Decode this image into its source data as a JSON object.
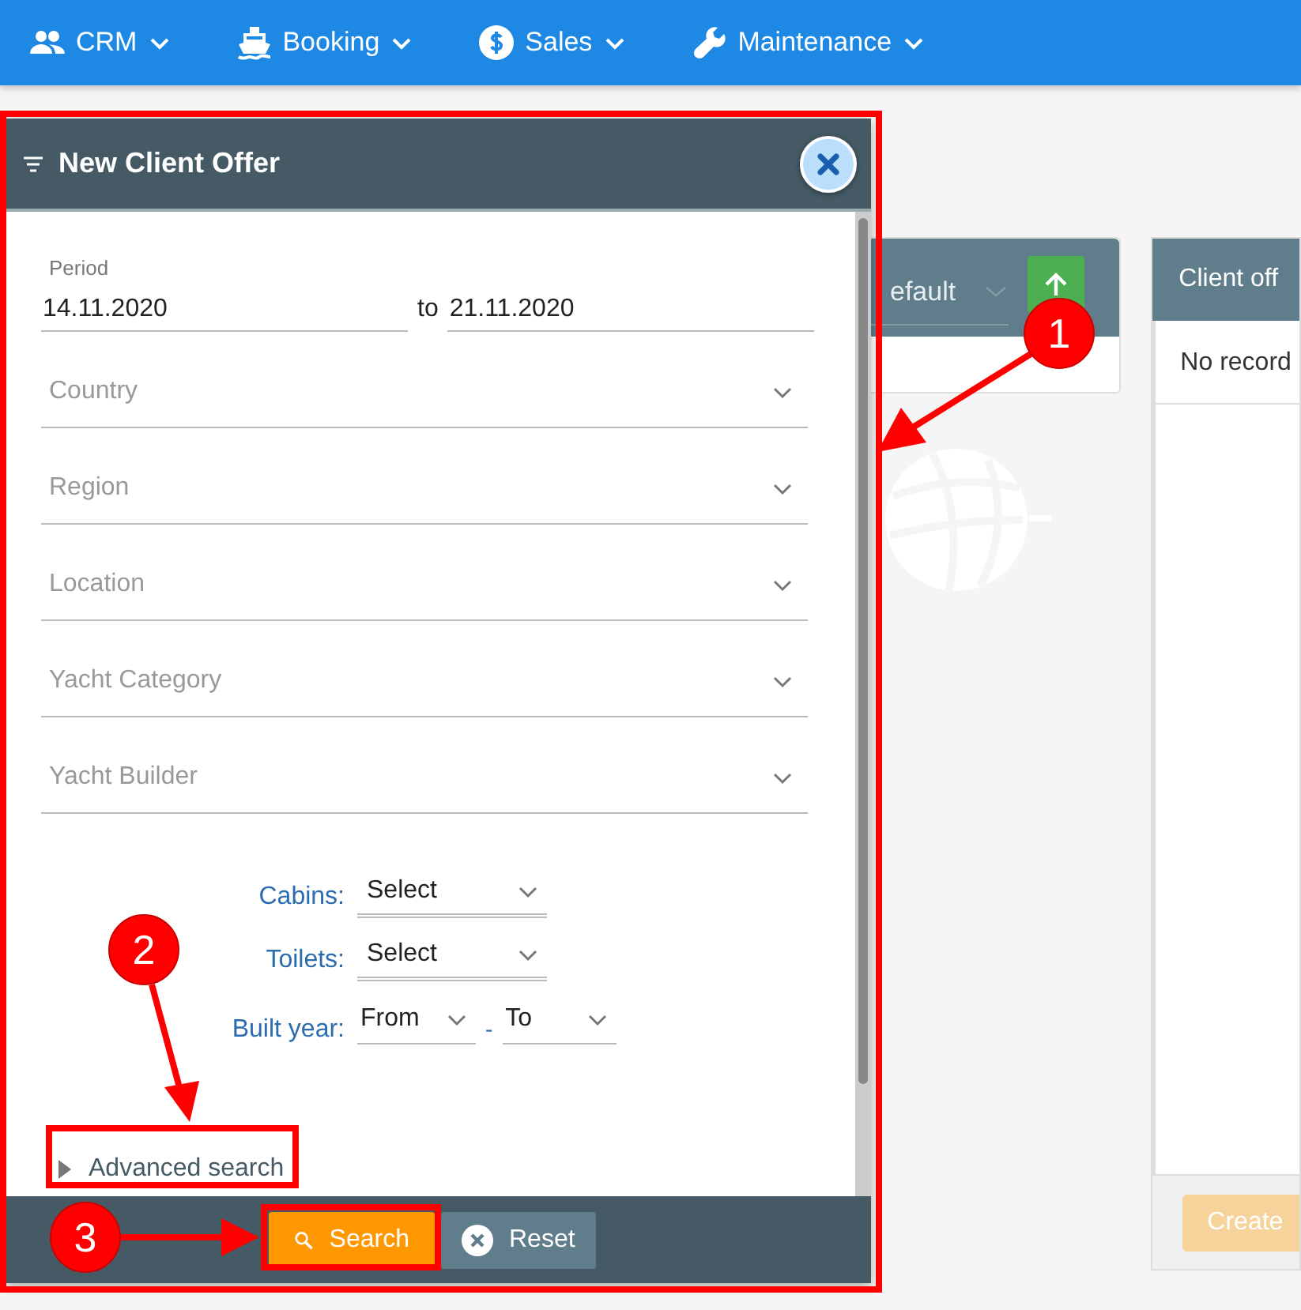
{
  "nav": [
    {
      "label": "CRM"
    },
    {
      "label": "Booking"
    },
    {
      "label": "Sales"
    },
    {
      "label": "Maintenance"
    }
  ],
  "background_cards": [
    {
      "kind": "filter",
      "title": "efault"
    },
    {
      "kind": "list",
      "title": "Client off",
      "empty_text": "No record",
      "button": "Create"
    }
  ],
  "dialog": {
    "title": "New Client Offer",
    "period": {
      "label": "Period",
      "from": "14.11.2020",
      "separator": "to",
      "to": "21.11.2020"
    },
    "selects": [
      {
        "placeholder": "Country"
      },
      {
        "placeholder": "Region"
      },
      {
        "placeholder": "Location"
      },
      {
        "placeholder": "Yacht Category"
      },
      {
        "placeholder": "Yacht Builder"
      }
    ],
    "small_selects": [
      {
        "label": "Cabins:",
        "value": "Select"
      },
      {
        "label": "Toilets:",
        "value": "Select"
      }
    ],
    "built_year": {
      "label": "Built year:",
      "from": "From",
      "separator": "-",
      "to": "To"
    },
    "advanced_search": {
      "label": "Advanced search",
      "expanded": false
    },
    "buttons": [
      {
        "kind": "primary",
        "label": "Search"
      },
      {
        "kind": "secondary",
        "label": "Reset"
      }
    ]
  },
  "annotations": [
    {
      "number": "1"
    },
    {
      "number": "2"
    },
    {
      "number": "3"
    }
  ]
}
